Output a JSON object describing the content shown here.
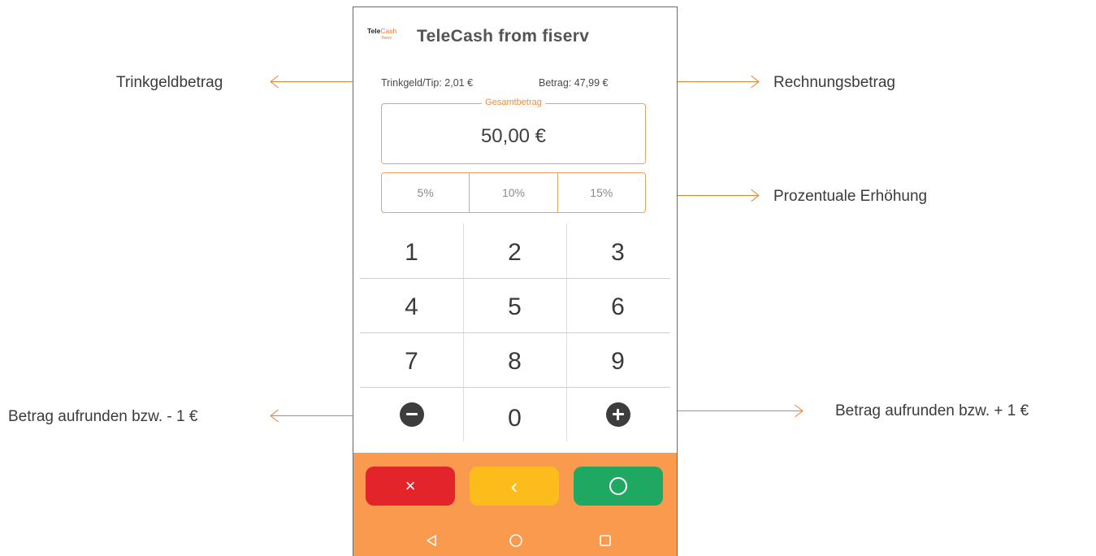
{
  "annotations": {
    "tip_amount": "Trinkgeldbetrag",
    "invoice_amount": "Rechnungsbetrag",
    "percent_increase": "Prozentuale Erhöhung",
    "round_down": "Betrag aufrunden bzw. - 1 €",
    "round_up": "Betrag aufrunden bzw. + 1 €"
  },
  "app": {
    "logo_text_a": "Tele",
    "logo_text_b": "Cash",
    "logo_sub": "fiserv",
    "title": "TeleCash from fiserv"
  },
  "amounts": {
    "tip": "Trinkgeld/Tip: 2,01 €",
    "invoice": "Betrag: 47,99 €",
    "total_label": "Gesamtbetrag",
    "total_value": "50,00 €"
  },
  "percent_buttons": [
    "5%",
    "10%",
    "15%"
  ],
  "keypad": {
    "keys": [
      "1",
      "2",
      "3",
      "4",
      "5",
      "6",
      "7",
      "8",
      "9"
    ],
    "zero": "0",
    "minus_icon": "minus-circle-icon",
    "plus_icon": "plus-circle-icon"
  },
  "actions": {
    "cancel": "×",
    "back": "‹",
    "cancel_color": "#e3242b",
    "back_color": "#fcbc1c",
    "confirm_color": "#1fa862",
    "bar_color": "#f99a4f"
  },
  "nav": {
    "back_icon": "nav-back-triangle-icon",
    "home_icon": "nav-home-circle-icon",
    "recents_icon": "nav-recents-square-icon"
  },
  "accent_color": "#f07a2a"
}
